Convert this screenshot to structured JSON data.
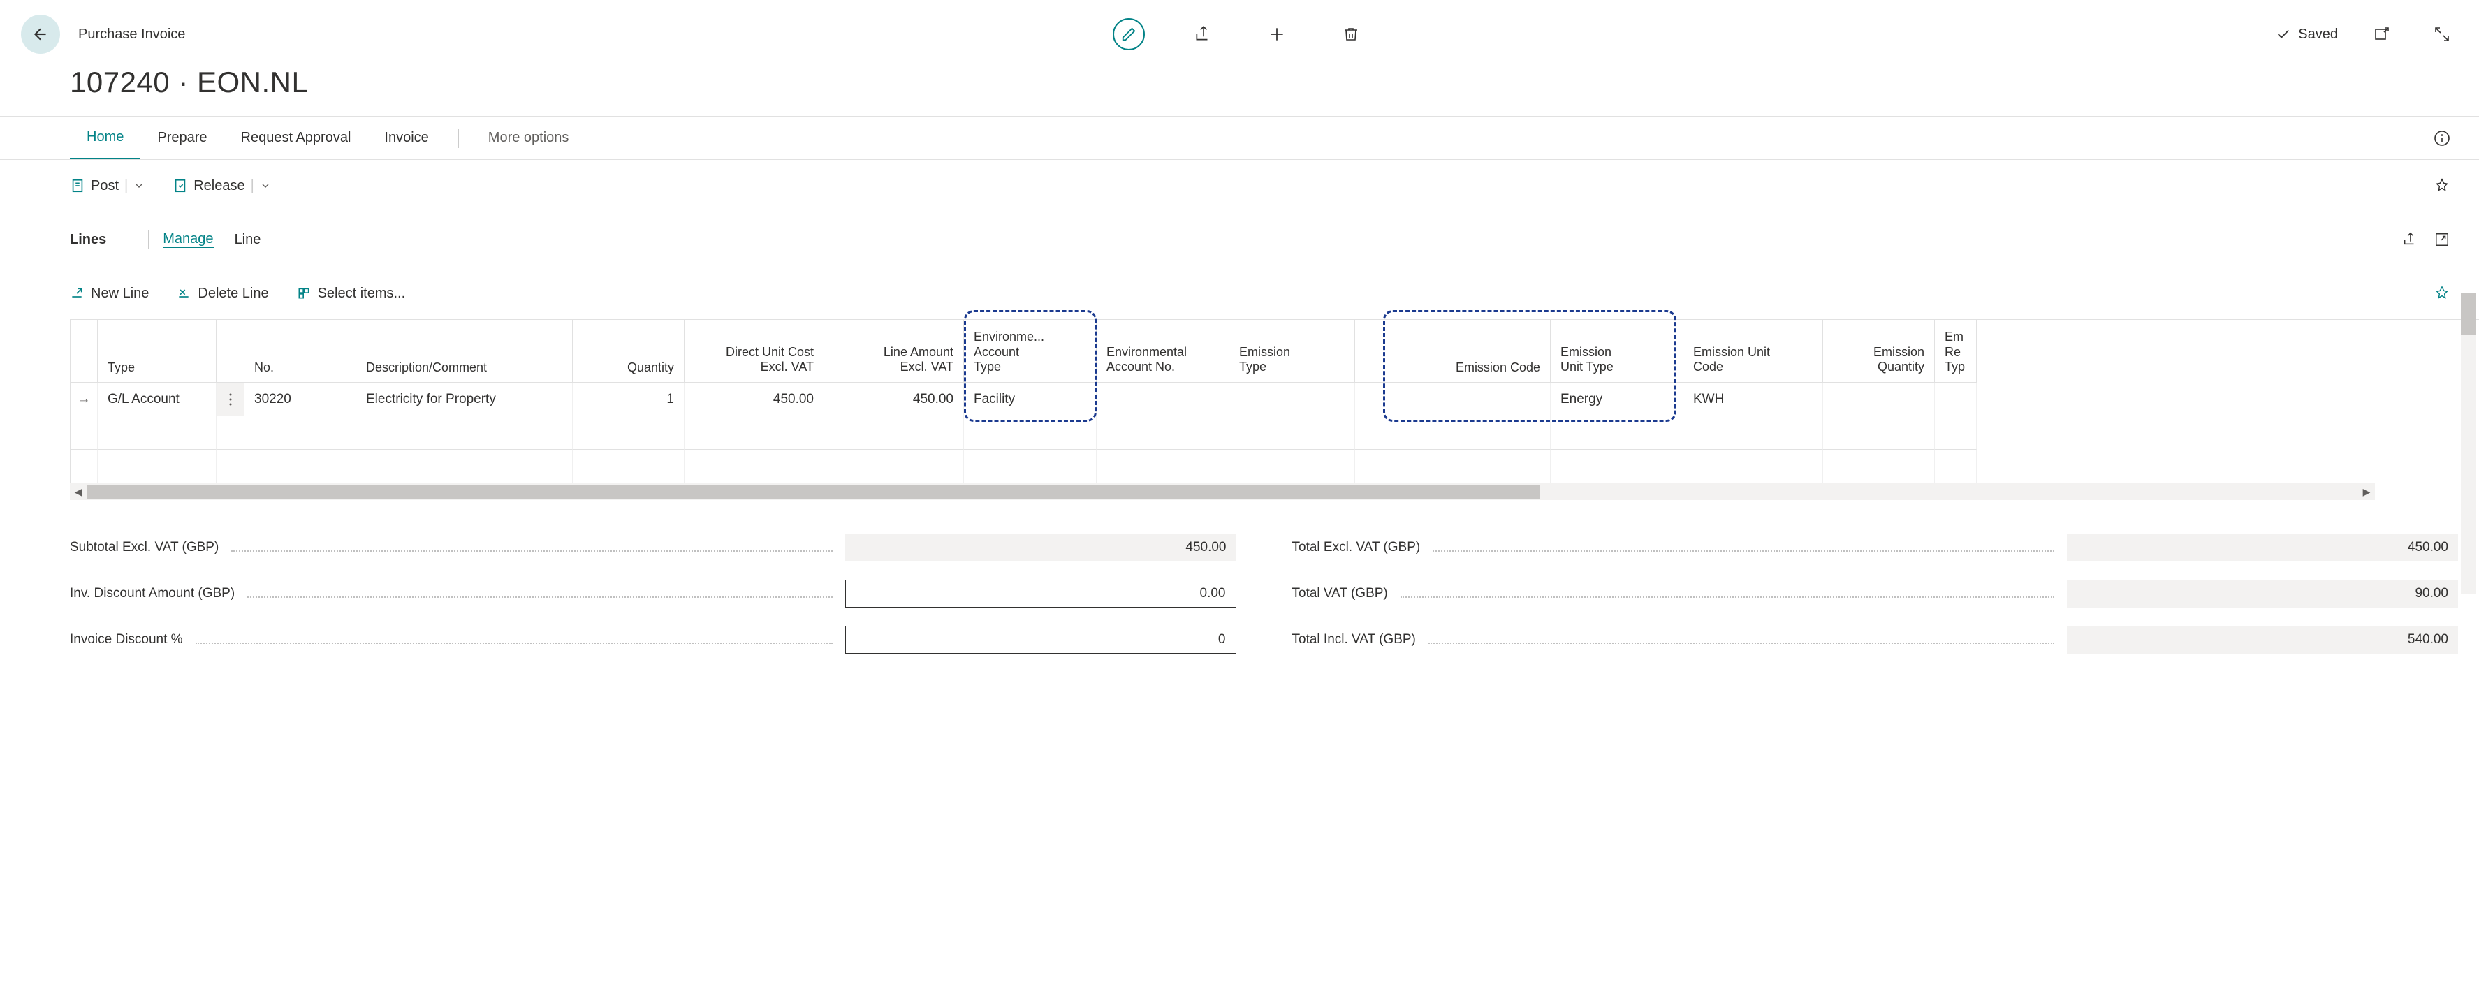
{
  "breadcrumb": "Purchase Invoice",
  "title": "107240 · EON.NL",
  "saved_label": "Saved",
  "nav": {
    "home": "Home",
    "prepare": "Prepare",
    "request_approval": "Request Approval",
    "invoice": "Invoice",
    "more_options": "More options"
  },
  "actionbar": {
    "post": "Post",
    "release": "Release"
  },
  "lines_header": {
    "title": "Lines",
    "manage": "Manage",
    "line": "Line"
  },
  "row_toolbar": {
    "new_line": "New Line",
    "delete_line": "Delete Line",
    "select_items": "Select items..."
  },
  "grid": {
    "headers": {
      "type": "Type",
      "no": "No.",
      "description": "Description/Comment",
      "quantity": "Quantity",
      "direct_unit_cost_l1": "Direct Unit Cost",
      "direct_unit_cost_l2": "Excl. VAT",
      "line_amount_l1": "Line Amount",
      "line_amount_l2": "Excl. VAT",
      "env_acct_type_l1": "Environme...",
      "env_acct_type_l2": "Account",
      "env_acct_type_l3": "Type",
      "env_acct_no_l1": "Environmental",
      "env_acct_no_l2": "Account No.",
      "emission_type_l1": "Emission",
      "emission_type_l2": "Type",
      "emission_code": "Emission Code",
      "emission_unit_type_l1": "Emission",
      "emission_unit_type_l2": "Unit Type",
      "emission_unit_code_l1": "Emission Unit",
      "emission_unit_code_l2": "Code",
      "emission_qty_l1": "Emission",
      "emission_qty_l2": "Quantity",
      "em_re_l1": "Em",
      "em_re_l2": "Re",
      "em_re_l3": "Typ"
    },
    "row0": {
      "type": "G/L Account",
      "no": "30220",
      "description": "Electricity for Property",
      "quantity": "1",
      "direct_unit_cost": "450.00",
      "line_amount": "450.00",
      "env_acct_type": "Facility",
      "env_acct_no": "",
      "emission_type": "",
      "emission_code": "",
      "emission_unit_type": "Energy",
      "emission_unit_code": "KWH",
      "emission_quantity": ""
    }
  },
  "totals": {
    "subtotal_excl_vat_label": "Subtotal Excl. VAT (GBP)",
    "subtotal_excl_vat_value": "450.00",
    "inv_discount_amount_label": "Inv. Discount Amount (GBP)",
    "inv_discount_amount_value": "0.00",
    "invoice_discount_pct_label": "Invoice Discount %",
    "invoice_discount_pct_value": "0",
    "total_excl_vat_label": "Total Excl. VAT (GBP)",
    "total_excl_vat_value": "450.00",
    "total_vat_label": "Total VAT (GBP)",
    "total_vat_value": "90.00",
    "total_incl_vat_label": "Total Incl. VAT (GBP)",
    "total_incl_vat_value": "540.00"
  }
}
